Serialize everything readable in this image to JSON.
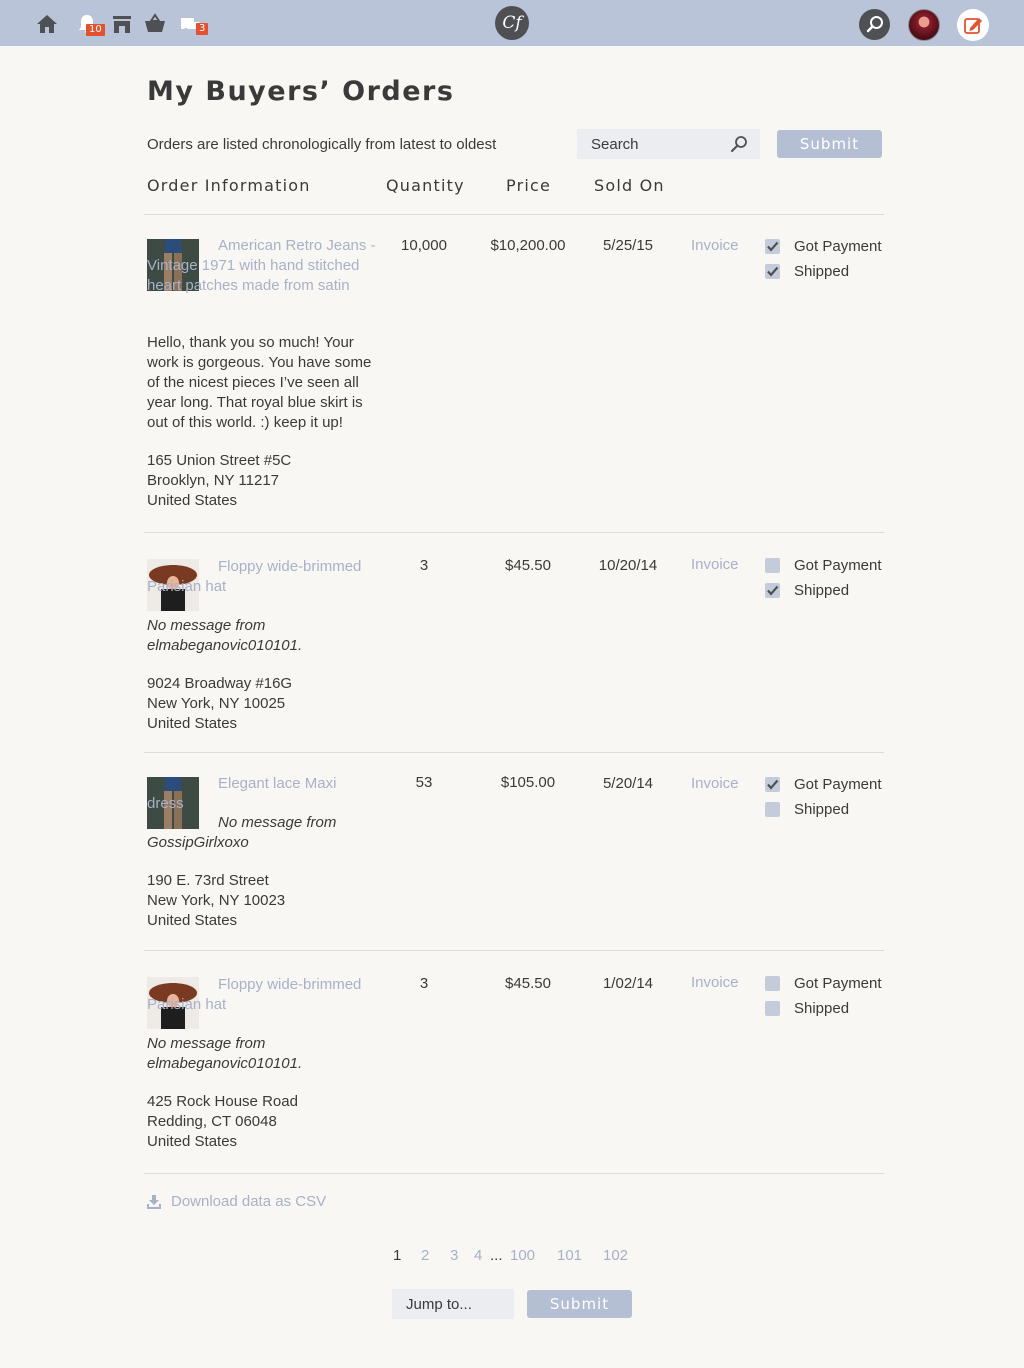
{
  "topbar": {
    "logo_text": "Cf",
    "notifications_count": "10",
    "shipping_count": "3"
  },
  "page": {
    "title": "My Buyers’ Orders",
    "subtitle": "Orders are listed chronologically from latest to oldest",
    "search_placeholder": "Search",
    "submit_label": "Submit"
  },
  "columns": {
    "order_info": "Order Information",
    "quantity": "Quantity",
    "price": "Price",
    "sold_on": "Sold On"
  },
  "orders": [
    {
      "product": "American Retro Jeans - Vintage 1971 with hand stitched heart patches made from satin",
      "message": "Hello, thank you so much! Your work is gorgeous. You have some of the nicest pieces I’ve seen all year long. That royal blue skirt is out of this world. :) keep it up!",
      "address1": "165 Union Street #5C",
      "address2": "Brooklyn, NY 11217",
      "address3": "United States",
      "quantity": "10,000",
      "price": "$10,200.00",
      "sold_on": "5/25/15",
      "invoice": "Invoice",
      "got_payment_label": "Got Payment",
      "got_payment": true,
      "shipped_label": "Shipped",
      "shipped": true
    },
    {
      "product": "Floppy wide-brimmed Parisian hat",
      "message": "No message from elmabeganovic010101.",
      "address1": "9024 Broadway #16G",
      "address2": "New York, NY 10025",
      "address3": "United States",
      "quantity": "3",
      "price": "$45.50",
      "sold_on": "10/20/14",
      "invoice": "Invoice",
      "got_payment_label": "Got Payment",
      "got_payment": false,
      "shipped_label": "Shipped",
      "shipped": true
    },
    {
      "product": "Elegant lace Maxi dress",
      "message": "No message from GossipGirlxoxo",
      "address1": "190 E. 73rd Street",
      "address2": "New York, NY 10023",
      "address3": "United States",
      "quantity": "53",
      "price": "$105.00",
      "sold_on": "5/20/14",
      "invoice": "Invoice",
      "got_payment_label": "Got Payment",
      "got_payment": true,
      "shipped_label": "Shipped",
      "shipped": false
    },
    {
      "product": "Floppy wide-brimmed Parisian hat",
      "message": "No message from elmabeganovic010101.",
      "address1": "425 Rock House Road",
      "address2": "Redding, CT 06048",
      "address3": "United States",
      "quantity": "3",
      "price": "$45.50",
      "sold_on": "1/02/14",
      "invoice": "Invoice",
      "got_payment_label": "Got Payment",
      "got_payment": false,
      "shipped_label": "Shipped",
      "shipped": false
    }
  ],
  "download_csv": "Download data as CSV",
  "pagination": {
    "pages": [
      "1",
      "2",
      "3",
      "4",
      "...",
      "100",
      "101",
      "102"
    ],
    "current": "1",
    "jump_placeholder": "Jump to...",
    "submit_label": "Submit"
  },
  "colors": {
    "topbar": "#b9c4d9",
    "accent_link": "#a8b1c7",
    "button": "#b5bfd3",
    "badge": "#e2522f",
    "background": "#f8f7f4"
  }
}
